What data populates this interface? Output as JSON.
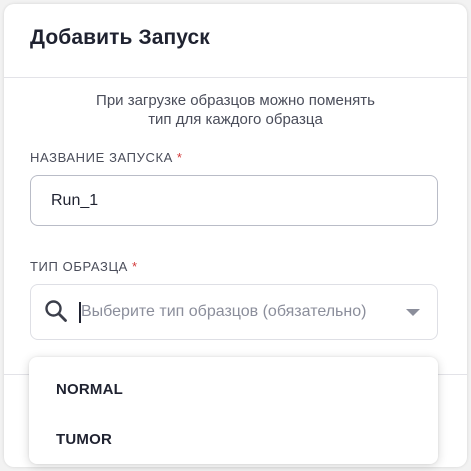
{
  "modal": {
    "title": "Добавить Запуск",
    "hint_line1": "При загрузке образцов можно поменять",
    "hint_line2": "тип для каждого образца"
  },
  "run_name": {
    "label": "НАЗВАНИЕ ЗАПУСКА",
    "required_mark": "*",
    "value": "Run_1"
  },
  "sample_type": {
    "label": "ТИП ОБРАЗЦА",
    "required_mark": "*",
    "placeholder": "Выберите тип образцов (обязательно)",
    "search_icon": "search-icon",
    "chevron_icon": "chevron-down-icon",
    "options": [
      {
        "label": "NORMAL"
      },
      {
        "label": "TUMOR"
      }
    ]
  },
  "colors": {
    "text": "#1f2230",
    "muted": "#4a4d5a",
    "placeholder": "#8b8e9b",
    "required": "#d23a3a",
    "border": "#b9bcc7"
  }
}
